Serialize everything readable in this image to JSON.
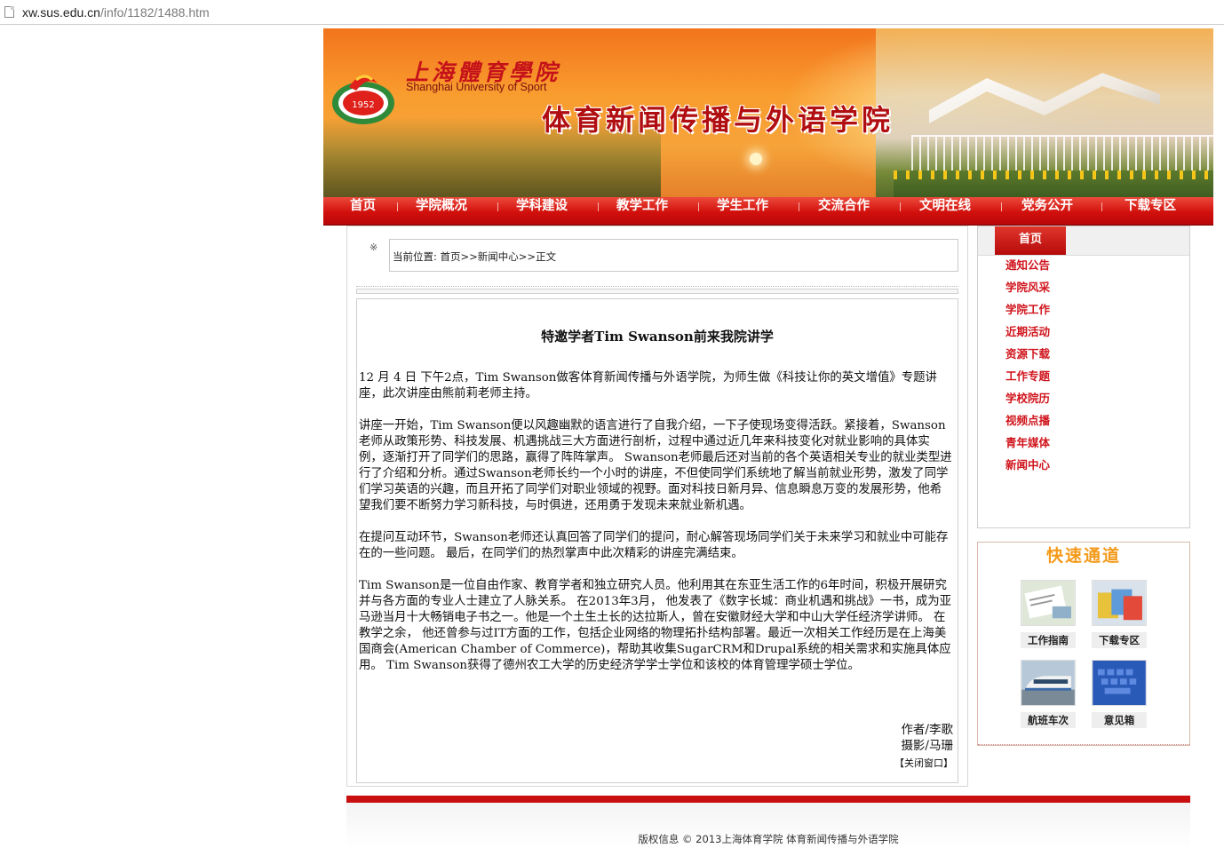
{
  "browser": {
    "url_host": "xw.sus.edu.cn",
    "url_path": "/info/1182/1488.htm"
  },
  "header": {
    "university_cn": "上海體育學院",
    "university_en": "Shanghai University of Sport",
    "college_name": "体育新闻传播与外语学院",
    "emblem_year": "1952"
  },
  "nav": {
    "items": [
      {
        "label": "首页"
      },
      {
        "label": "学院概况"
      },
      {
        "label": "学科建设"
      },
      {
        "label": "教学工作"
      },
      {
        "label": "学生工作"
      },
      {
        "label": "交流合作"
      },
      {
        "label": "文明在线"
      },
      {
        "label": "党务公开"
      },
      {
        "label": "下载专区"
      }
    ]
  },
  "breadcrumb": {
    "marker": "※",
    "text": "当前位置: 首页>>新闻中心>>正文"
  },
  "article": {
    "title": "特邀学者Tim Swanson前来我院讲学",
    "paragraphs": [
      "12 月 4 日 下午2点，Tim Swanson做客体育新闻传播与外语学院，为师生做《科技让你的英文增值》专题讲座，此次讲座由熊前莉老师主持。",
      "讲座一开始，Tim Swanson便以风趣幽默的语言进行了自我介绍，一下子使现场变得活跃。紧接着，Swanson老师从政策形势、科技发展、机遇挑战三大方面进行剖析，过程中通过近几年来科技变化对就业影响的具体实例，逐渐打开了同学们的思路，赢得了阵阵掌声。 Swanson老师最后还对当前的各个英语相关专业的就业类型进行了介绍和分析。通过Swanson老师长约一个小时的讲座，不但使同学们系统地了解当前就业形势，激发了同学们学习英语的兴趣，而且开拓了同学们对职业领域的视野。面对科技日新月异、信息瞬息万变的发展形势，他希望我们要不断努力学习新科技，与时俱进，还用勇于发现未来就业新机遇。",
      "在提问互动环节，Swanson老师还认真回答了同学们的提问，耐心解答现场同学们关于未来学习和就业中可能存在的一些问题。 最后，在同学们的热烈掌声中此次精彩的讲座完满结束。",
      "Tim Swanson是一位自由作家、教育学者和独立研究人员。他利用其在东亚生活工作的6年时间，积极开展研究并与各方面的专业人士建立了人脉关系。 在2013年3月， 他发表了《数字长城：商业机遇和挑战》一书，成为亚马逊当月十大畅销电子书之一。他是一个土生土长的达拉斯人，曾在安徽财经大学和中山大学任经济学讲师。 在教学之余， 他还曾参与过IT方面的工作，包括企业网络的物理拓扑结构部署。最近一次相关工作经历是在上海美国商会(American Chamber of Commerce)，帮助其收集SugarCRM和Drupal系统的相关需求和实施具体应用。 Tim Swanson获得了德州农工大学的历史经济学学士学位和该校的体育管理学硕士学位。"
    ],
    "author": "作者/李歌",
    "photographer": "摄影/马珊",
    "close_link": "【关闭窗口】"
  },
  "sidebar": {
    "tab_label": "首页",
    "items": [
      {
        "label": "通知公告"
      },
      {
        "label": "学院风采"
      },
      {
        "label": "学院工作"
      },
      {
        "label": "近期活动"
      },
      {
        "label": "资源下载"
      },
      {
        "label": "工作专题"
      },
      {
        "label": "学校院历"
      },
      {
        "label": "视频点播"
      },
      {
        "label": "青年媒体"
      },
      {
        "label": "新闻中心"
      }
    ]
  },
  "quick_access": {
    "title": "快速通道",
    "items": [
      {
        "label": "工作指南"
      },
      {
        "label": "下载专区"
      },
      {
        "label": "航班车次"
      },
      {
        "label": "意见箱"
      }
    ]
  },
  "footer": {
    "text": "版权信息 © 2013上海体育学院 体育新闻传播与外语学院"
  },
  "colors": {
    "brand_red": "#c90f10",
    "nav_red": "#d2100c",
    "link_red": "#d0141c",
    "quick_orange": "#f39a1a"
  }
}
